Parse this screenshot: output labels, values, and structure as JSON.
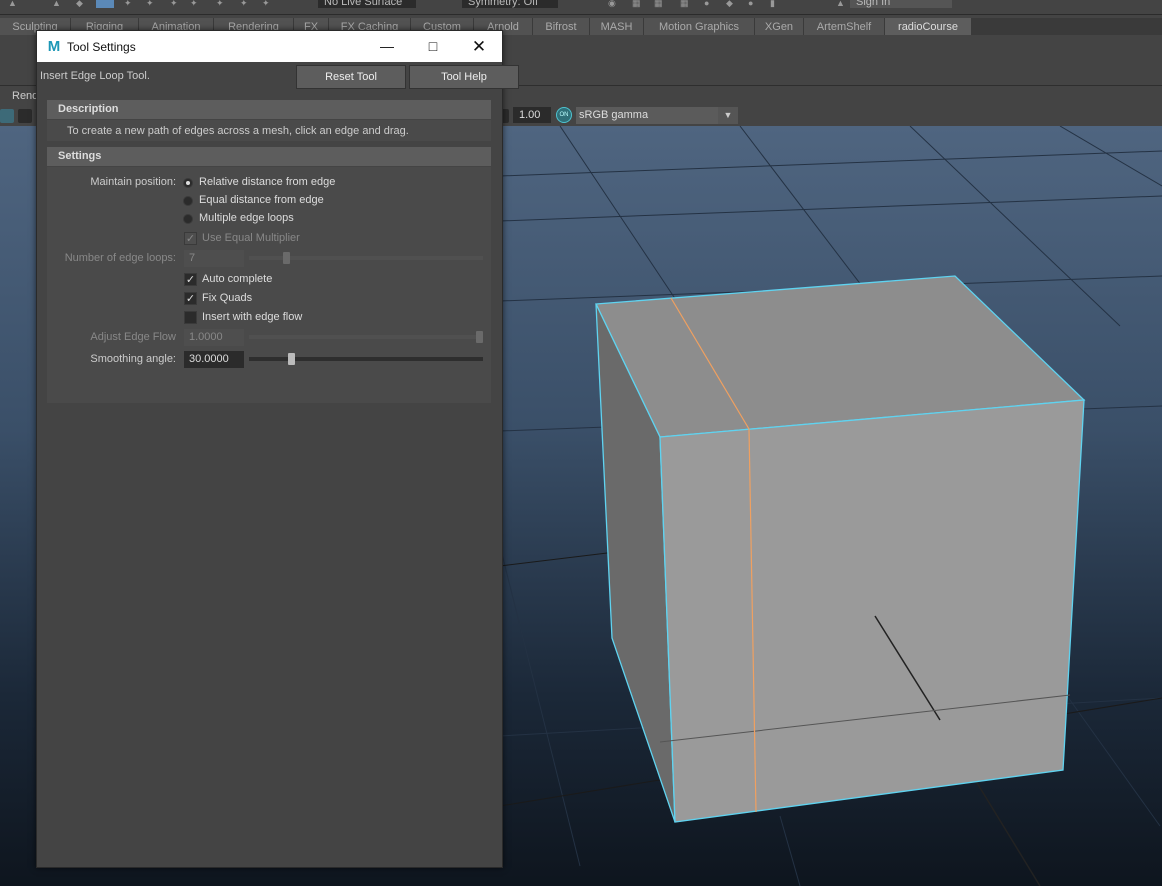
{
  "toolbar": {
    "live_surface": "No Live Surface",
    "symmetry": "Symmetry: Off",
    "sign_in": "Sign In"
  },
  "shelf_tabs": [
    {
      "label": "Sculpting",
      "active": false
    },
    {
      "label": "Rigging",
      "active": false
    },
    {
      "label": "Animation",
      "active": false
    },
    {
      "label": "Rendering",
      "active": false
    },
    {
      "label": "FX",
      "active": false
    },
    {
      "label": "FX Caching",
      "active": false
    },
    {
      "label": "Custom",
      "active": false
    },
    {
      "label": "Arnold",
      "active": false
    },
    {
      "label": "Bifrost",
      "active": false
    },
    {
      "label": "MASH",
      "active": false
    },
    {
      "label": "Motion Graphics",
      "active": false
    },
    {
      "label": "XGen",
      "active": false
    },
    {
      "label": "ArtemShelf",
      "active": false
    },
    {
      "label": "radioCourse",
      "active": true
    }
  ],
  "panel_menu": {
    "renderer_label": "Rend"
  },
  "panel_toolbar": {
    "exposure_value": "1.00",
    "gamma_icon": "gamma-toggle-icon",
    "color_space": "sRGB gamma"
  },
  "tool_settings": {
    "window_title": "Tool Settings",
    "app_icon_letter": "M",
    "tool_name": "Insert Edge Loop Tool.",
    "reset_button": "Reset Tool",
    "help_button": "Tool Help",
    "description": {
      "header": "Description",
      "text": "To create a new path of edges across a mesh, click an edge and drag."
    },
    "settings": {
      "header": "Settings",
      "maintain_position_label": "Maintain position:",
      "maintain_position_options": [
        {
          "label": "Relative distance from edge",
          "selected": true
        },
        {
          "label": "Equal distance from edge",
          "selected": false
        },
        {
          "label": "Multiple edge loops",
          "selected": false
        }
      ],
      "use_equal_multiplier": {
        "label": "Use Equal Multiplier",
        "checked": true,
        "enabled": false
      },
      "number_of_edge_loops": {
        "label": "Number of edge loops:",
        "value": "7",
        "enabled": false,
        "fraction": 0.15
      },
      "auto_complete": {
        "label": "Auto complete",
        "checked": true
      },
      "fix_quads": {
        "label": "Fix Quads",
        "checked": true
      },
      "insert_with_edge_flow": {
        "label": "Insert with edge flow",
        "checked": false
      },
      "adjust_edge_flow": {
        "label": "Adjust Edge Flow",
        "value": "1.0000",
        "enabled": false,
        "fraction": 1.0
      },
      "smoothing_angle": {
        "label": "Smoothing angle:",
        "value": "30.0000",
        "enabled": true,
        "fraction": 0.17
      }
    }
  },
  "colors": {
    "selection_wire": "#5fd3f0",
    "inserted_edge": "#f0a060",
    "cube_front": "#9a9a9a",
    "cube_top": "#8c8c8c",
    "cube_side": "#6e6e6e"
  }
}
